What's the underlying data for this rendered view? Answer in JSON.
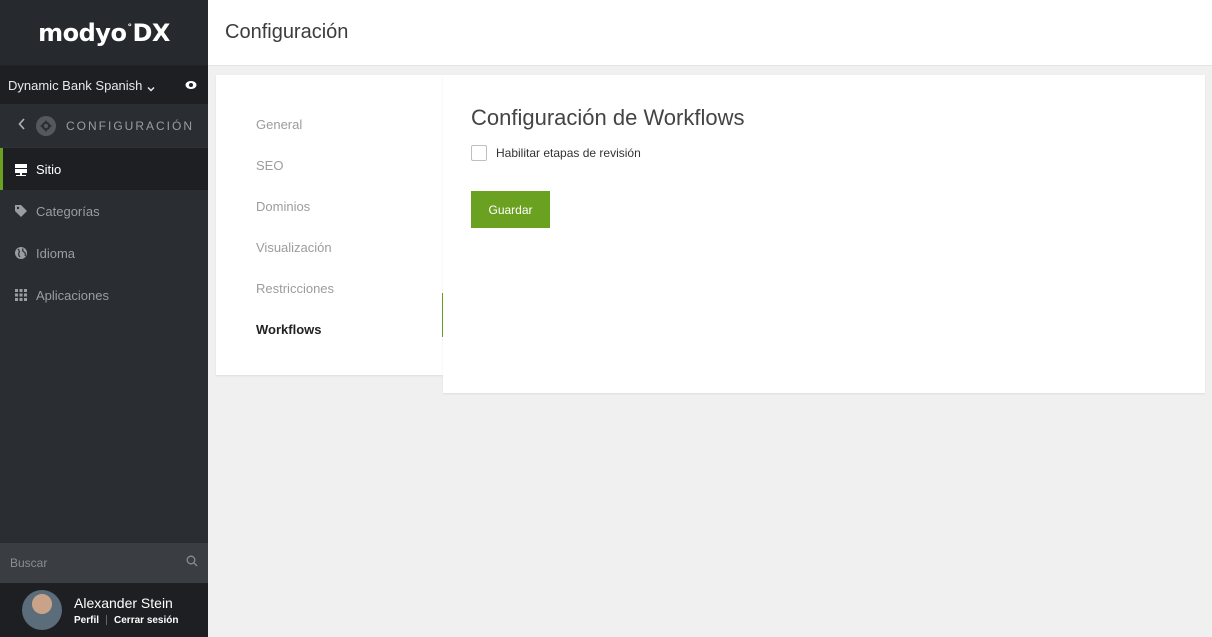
{
  "app": {
    "logo_text": "modyo",
    "logo_suffix": "DX",
    "logo_mark": "°"
  },
  "sidebar": {
    "site_selector": "Dynamic Bank Spanish",
    "section_label": "CONFIGURACIÓN",
    "items": [
      {
        "label": "Sitio",
        "icon": "server-icon",
        "active": true
      },
      {
        "label": "Categorías",
        "icon": "tag-icon",
        "active": false
      },
      {
        "label": "Idioma",
        "icon": "globe-icon",
        "active": false
      },
      {
        "label": "Aplicaciones",
        "icon": "grid-icon",
        "active": false
      }
    ],
    "search_placeholder": "Buscar"
  },
  "user": {
    "name": "Alexander Stein",
    "profile_link": "Perfil",
    "logout_link": "Cerrar sesión"
  },
  "header": {
    "title": "Configuración"
  },
  "subnav": {
    "items": [
      {
        "label": "General",
        "active": false
      },
      {
        "label": "SEO",
        "active": false
      },
      {
        "label": "Dominios",
        "active": false
      },
      {
        "label": "Visualización",
        "active": false
      },
      {
        "label": "Restricciones",
        "active": false
      },
      {
        "label": "Workflows",
        "active": true
      }
    ]
  },
  "main": {
    "section_title": "Configuración de Workflows",
    "checkbox_label": "Habilitar etapas de revisión",
    "checkbox_checked": false,
    "save_label": "Guardar"
  },
  "colors": {
    "accent": "#6aa121",
    "sidebar_bg": "#2a2d31",
    "sidebar_dark": "#1d1f22"
  }
}
